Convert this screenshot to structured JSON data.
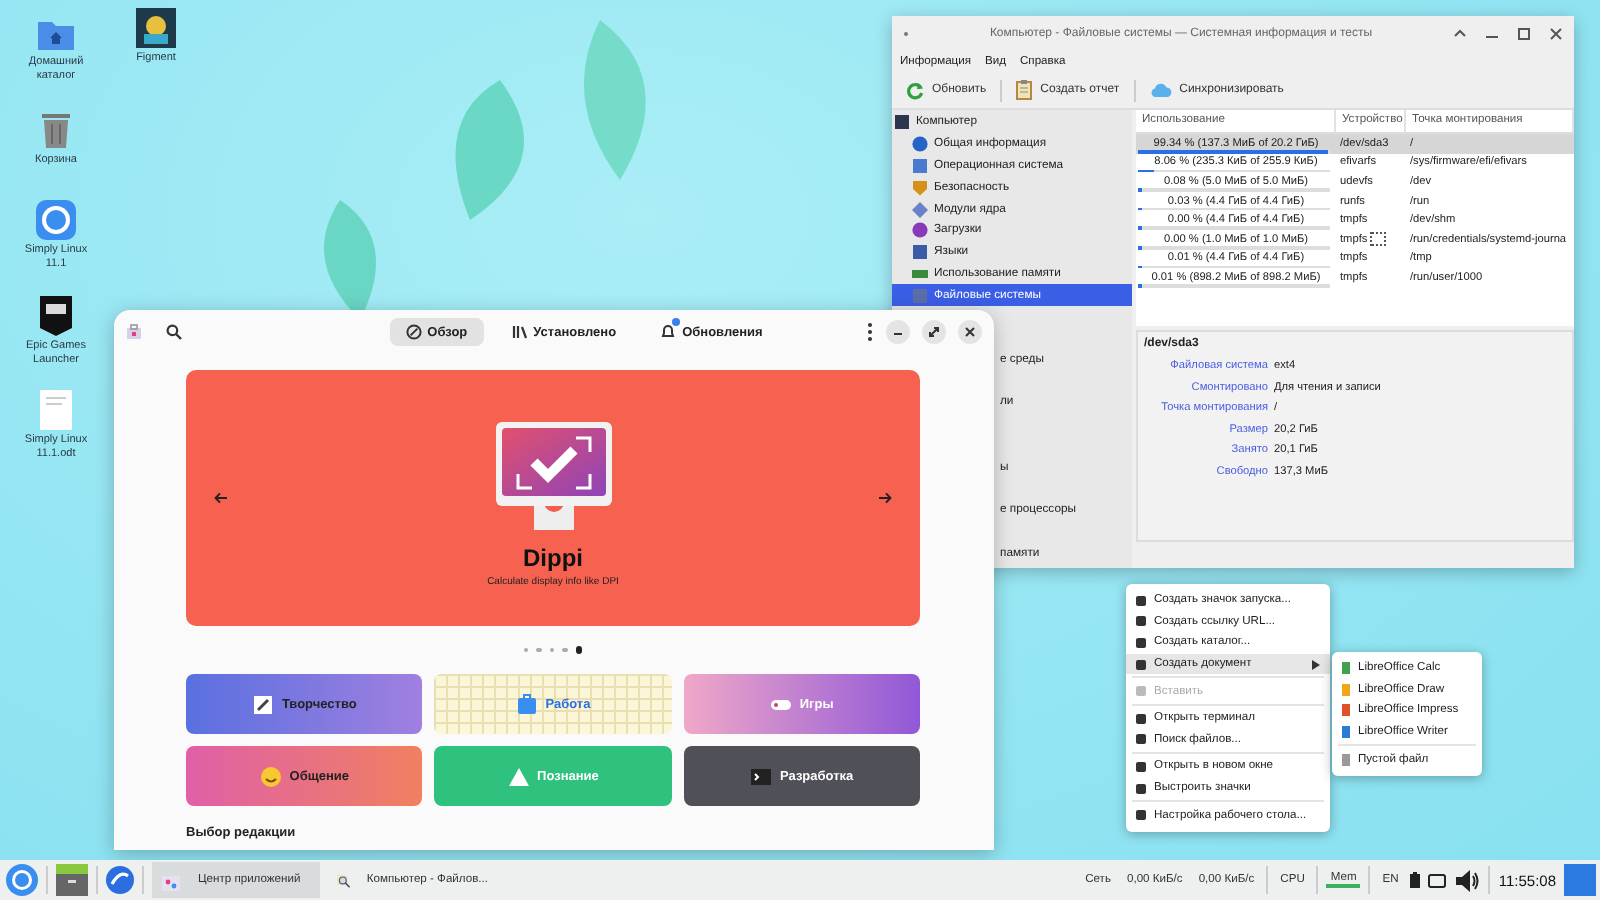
{
  "desktop_icons": [
    {
      "label": "Домашний каталог"
    },
    {
      "label": "Figment"
    },
    {
      "label": "Корзина"
    },
    {
      "label": "Simply Linux 11.1"
    },
    {
      "label": "Epic Games Launcher"
    },
    {
      "label": "Simply Linux 11.1.odt"
    }
  ],
  "sysinfo_window": {
    "title": "Компьютер - Файловые системы — Системная информация и тесты",
    "menu": [
      "Информация",
      "Вид",
      "Справка"
    ],
    "toolbar": [
      "Обновить",
      "Создать отчет",
      "Синхронизировать"
    ],
    "sidebar": {
      "items": [
        {
          "label": "Компьютер",
          "selected": false
        },
        {
          "label": "Общая информация",
          "selected": false
        },
        {
          "label": "Операционная система",
          "selected": false
        },
        {
          "label": "Безопасность",
          "selected": false
        },
        {
          "label": "Модули ядра",
          "selected": false
        },
        {
          "label": "Загрузки",
          "selected": false
        },
        {
          "label": "Языки",
          "selected": false
        },
        {
          "label": "Использование памяти",
          "selected": false
        },
        {
          "label": "Файловые системы",
          "selected": true
        }
      ],
      "covered_items": [
        "е среды",
        "ли",
        "ы",
        "е процессоры",
        "памяти"
      ]
    },
    "table": {
      "columns": [
        "Использование",
        "Устройство",
        "Точка монтирования"
      ],
      "rows": [
        {
          "usage": "99.34 % (137.3 МиБ of 20.2 ГиБ)",
          "level": 0.9934,
          "device": "/dev/sda3",
          "mount": "/",
          "selected": true,
          "marked": false
        },
        {
          "usage": "8.06 % (235.3 КиБ of 255.9 КиБ)",
          "level": 0.0806,
          "device": "efivarfs",
          "mount": "/sys/firmware/efi/efivars",
          "selected": false,
          "marked": false
        },
        {
          "usage": "0.08 % (5.0 МиБ of 5.0 МиБ)",
          "level": 0.0008,
          "device": "udevfs",
          "mount": "/dev",
          "selected": false,
          "marked": false
        },
        {
          "usage": "0.03 % (4.4 ГиБ of 4.4 ГиБ)",
          "level": 0.0003,
          "device": "runfs",
          "mount": "/run",
          "selected": false,
          "marked": false
        },
        {
          "usage": "0.00 % (4.4 ГиБ of 4.4 ГиБ)",
          "level": 0,
          "device": "tmpfs",
          "mount": "/dev/shm",
          "selected": false,
          "marked": false
        },
        {
          "usage": "0.00 % (1.0 МиБ of 1.0 МиБ)",
          "level": 0,
          "device": "tmpfs",
          "mount": "/run/credentials/systemd-journa",
          "selected": false,
          "marked": true
        },
        {
          "usage": "0.01 % (4.4 ГиБ of 4.4 ГиБ)",
          "level": 0.0001,
          "device": "tmpfs",
          "mount": "/tmp",
          "selected": false,
          "marked": false
        },
        {
          "usage": "0.01 % (898.2 МиБ of 898.2 МиБ)",
          "level": 0.0001,
          "device": "tmpfs",
          "mount": "/run/user/1000",
          "selected": false,
          "marked": false
        }
      ]
    },
    "details": {
      "title": "/dev/sda3",
      "fields": [
        {
          "label": "Файловая система",
          "value": "ext4"
        },
        {
          "label": "Смонтировано",
          "value": "Для чтения и записи"
        },
        {
          "label": "Точка монтирования",
          "value": "/"
        },
        {
          "label": "Размер",
          "value": "20,2 ГиБ"
        },
        {
          "label": "Занято",
          "value": "20,1 ГиБ"
        },
        {
          "label": "Свободно",
          "value": "137,3 МиБ"
        }
      ]
    }
  },
  "app_center": {
    "tabs": [
      {
        "label": "Обзор",
        "selected": true
      },
      {
        "label": "Установлено",
        "selected": false
      },
      {
        "label": "Обновления",
        "selected": false
      }
    ],
    "banner": {
      "title": "Dippi",
      "subtitle": "Calculate display info like DPI",
      "pages": [
        {
          "selected": false
        },
        {
          "selected": false
        },
        {
          "selected": false
        },
        {
          "selected": false
        },
        {
          "selected": true
        }
      ]
    },
    "categories": [
      {
        "label": "Творчество"
      },
      {
        "label": "Работа"
      },
      {
        "label": "Игры"
      },
      {
        "label": "Общение"
      },
      {
        "label": "Познание"
      },
      {
        "label": "Разработка"
      }
    ],
    "section_title": "Выбор редакции"
  },
  "context_menu": {
    "items": [
      {
        "kind": "item",
        "label": "Создать значок запуска...",
        "disabled": false,
        "selected": false,
        "submenu": false
      },
      {
        "kind": "item",
        "label": "Создать ссылку URL...",
        "disabled": false,
        "selected": false,
        "submenu": false
      },
      {
        "kind": "item",
        "label": "Создать каталог...",
        "disabled": false,
        "selected": false,
        "submenu": false
      },
      {
        "kind": "item",
        "label": "Создать документ",
        "disabled": false,
        "selected": true,
        "submenu": true
      },
      {
        "kind": "separator"
      },
      {
        "kind": "item",
        "label": "Вставить",
        "disabled": true,
        "selected": false,
        "submenu": false
      },
      {
        "kind": "separator"
      },
      {
        "kind": "item",
        "label": "Открыть терминал",
        "disabled": false,
        "selected": false,
        "submenu": false
      },
      {
        "kind": "item",
        "label": "Поиск файлов...",
        "disabled": false,
        "selected": false,
        "submenu": false
      },
      {
        "kind": "separator"
      },
      {
        "kind": "item",
        "label": "Открыть в новом окне",
        "disabled": false,
        "selected": false,
        "submenu": false
      },
      {
        "kind": "item",
        "label": "Выстроить значки",
        "disabled": false,
        "selected": false,
        "submenu": false
      },
      {
        "kind": "separator"
      },
      {
        "kind": "item",
        "label": "Настройка рабочего стола...",
        "disabled": false,
        "selected": false,
        "submenu": false
      }
    ],
    "submenu": [
      {
        "kind": "item",
        "label": "LibreOffice Calc",
        "color": "#3fa34d"
      },
      {
        "kind": "item",
        "label": "LibreOffice Draw",
        "color": "#f0a818"
      },
      {
        "kind": "item",
        "label": "LibreOffice Impress",
        "color": "#e0502a"
      },
      {
        "kind": "item",
        "label": "LibreOffice Writer",
        "color": "#2a7ad8"
      },
      {
        "kind": "separator"
      },
      {
        "kind": "item",
        "label": "Пустой файл",
        "color": "#9a9a9a"
      }
    ]
  },
  "taskbar": {
    "tasks": [
      {
        "label": "Центр приложений",
        "selected": true
      },
      {
        "label": "Компьютер - Файлов...",
        "selected": false
      }
    ],
    "network_label": "Сеть",
    "download": "0,00 КиБ/с",
    "upload": "0,00 КиБ/с",
    "cpu_label": "CPU",
    "mem_label": "Mem",
    "keyboard_layout": "EN",
    "clock": "11:55:08"
  }
}
